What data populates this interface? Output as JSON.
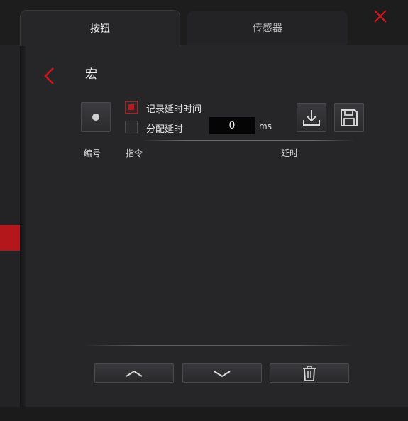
{
  "tabs": [
    {
      "label": "按钮",
      "active": true
    },
    {
      "label": "传感器",
      "active": false
    }
  ],
  "page_title": "宏",
  "options": {
    "record_delay_label": "记录延时时间",
    "record_delay_checked": true,
    "assign_delay_label": "分配延时",
    "assign_delay_checked": false,
    "delay_value": "0",
    "delay_unit": "ms"
  },
  "table": {
    "columns": [
      "编号",
      "指令",
      "延时"
    ],
    "rows": []
  },
  "icons": {
    "close": "close-icon",
    "back": "chevron-left-icon",
    "record": "record-dot-icon",
    "download": "download-icon",
    "save": "floppy-save-icon",
    "move_up": "chevron-up-icon",
    "move_down": "chevron-down-icon",
    "delete": "trash-icon"
  },
  "colors": {
    "accent": "#c0161c",
    "panel": "#262628",
    "background": "#1c1c1d"
  }
}
